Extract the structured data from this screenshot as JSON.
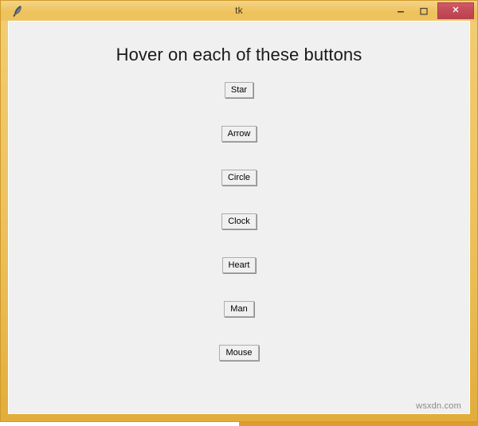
{
  "window": {
    "title": "tk",
    "app_icon": "feather-icon",
    "frame_color": "#eec261",
    "client_bg": "#f0f0f0",
    "controls": {
      "minimize_label": "–",
      "minimize_icon": "minimize-icon",
      "maximize_label": "▢",
      "maximize_icon": "maximize-icon",
      "close_label": "✕",
      "close_icon": "close-icon",
      "close_color": "#c44b58"
    }
  },
  "main": {
    "heading": "Hover on each of these buttons",
    "buttons": [
      {
        "label": "Star"
      },
      {
        "label": "Arrow"
      },
      {
        "label": "Circle"
      },
      {
        "label": "Clock"
      },
      {
        "label": "Heart"
      },
      {
        "label": "Man"
      },
      {
        "label": "Mouse"
      }
    ]
  },
  "watermark": {
    "text": "wsxdn.com"
  }
}
